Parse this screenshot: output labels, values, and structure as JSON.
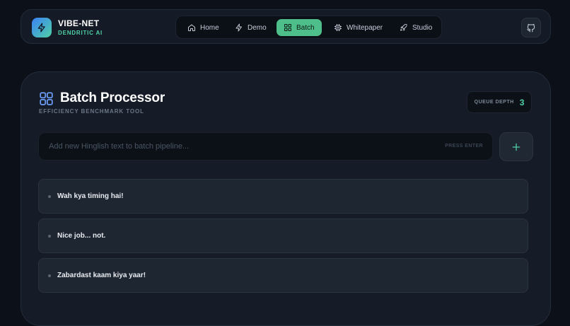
{
  "brand": {
    "title": "VIBE-NET",
    "subtitle": "DENDRITIC AI",
    "accent": "#4fd1a5"
  },
  "nav": {
    "items": [
      {
        "label": "Home",
        "icon": "home-icon"
      },
      {
        "label": "Demo",
        "icon": "lightning-icon"
      },
      {
        "label": "Batch",
        "icon": "grid-icon",
        "active": true
      },
      {
        "label": "Whitepaper",
        "icon": "chip-icon"
      },
      {
        "label": "Studio",
        "icon": "rocket-icon"
      }
    ],
    "active_color": "#4ebf8a"
  },
  "header": {
    "title": "Batch Processor",
    "subtitle": "EFFICIENCY BENCHMARK TOOL"
  },
  "queue": {
    "label": "QUEUE DEPTH",
    "value": "3"
  },
  "input": {
    "placeholder": "Add new Hinglish text to batch pipeline...",
    "value": "",
    "hint": "PRESS ENTER"
  },
  "items": [
    {
      "text": "Wah kya timing hai!"
    },
    {
      "text": "Nice job... not."
    },
    {
      "text": "Zabardast kaam kiya yaar!"
    }
  ]
}
